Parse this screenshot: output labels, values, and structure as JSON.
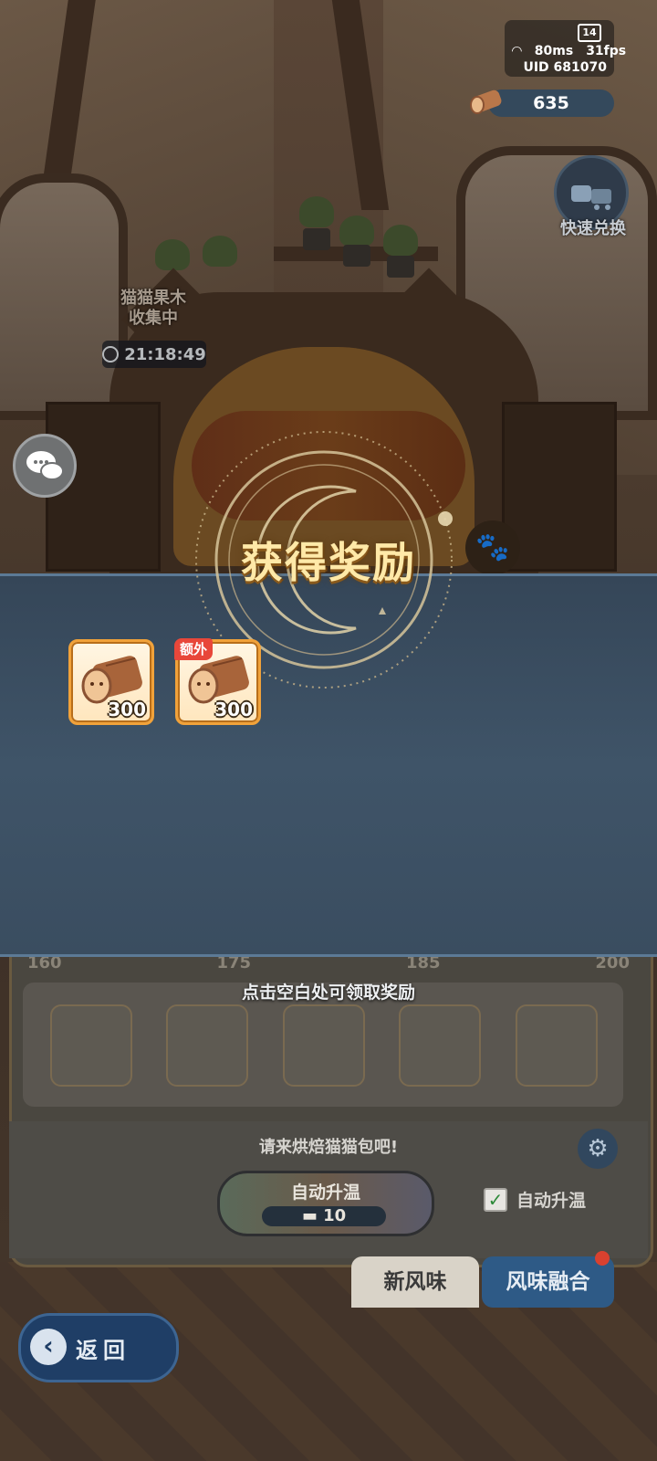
{
  "hud": {
    "network_ping": "80ms",
    "fps": "31fps",
    "uid_label": "UID",
    "uid_value": "681070",
    "badge": "14",
    "wood_count": "635",
    "quick_exchange_label": "快速兑换"
  },
  "collector": {
    "label_line1": "猫猫果木",
    "label_line2": "收集中",
    "timer": "21:18:49"
  },
  "reward": {
    "title": "获得奖励",
    "items": [
      {
        "quantity": "300",
        "tag": ""
      },
      {
        "quantity": "300",
        "tag": "额外"
      }
    ],
    "tap_hint": "点击空白处可领取奖励"
  },
  "panel": {
    "temps": [
      "160",
      "175",
      "185",
      "200"
    ],
    "bake_message": "请来烘焙猫猫包吧!",
    "auto_heat_button": "自动升温",
    "auto_heat_cost": "10",
    "auto_heat_checkbox": "自动升温",
    "auto_heat_checked": true
  },
  "tabs": {
    "new_flavor": "新风味",
    "flavor_fusion": "风味融合"
  },
  "nav": {
    "back": "返回"
  },
  "icons": {
    "wood": "wood-log-icon",
    "chat": "chat-bubbles-icon",
    "gear": "gear-icon",
    "back": "back-arrow-icon",
    "clock": "clock-icon",
    "wifi": "wifi-icon",
    "quick_exchange": "exchange-cart-icon",
    "paw": "paw-icon"
  },
  "colors": {
    "title_gold": "#ffe9a8",
    "banner_blue": "#3f5468",
    "extra_tag_red": "#e8473a",
    "fusion_tab_blue": "#2e5a86"
  }
}
